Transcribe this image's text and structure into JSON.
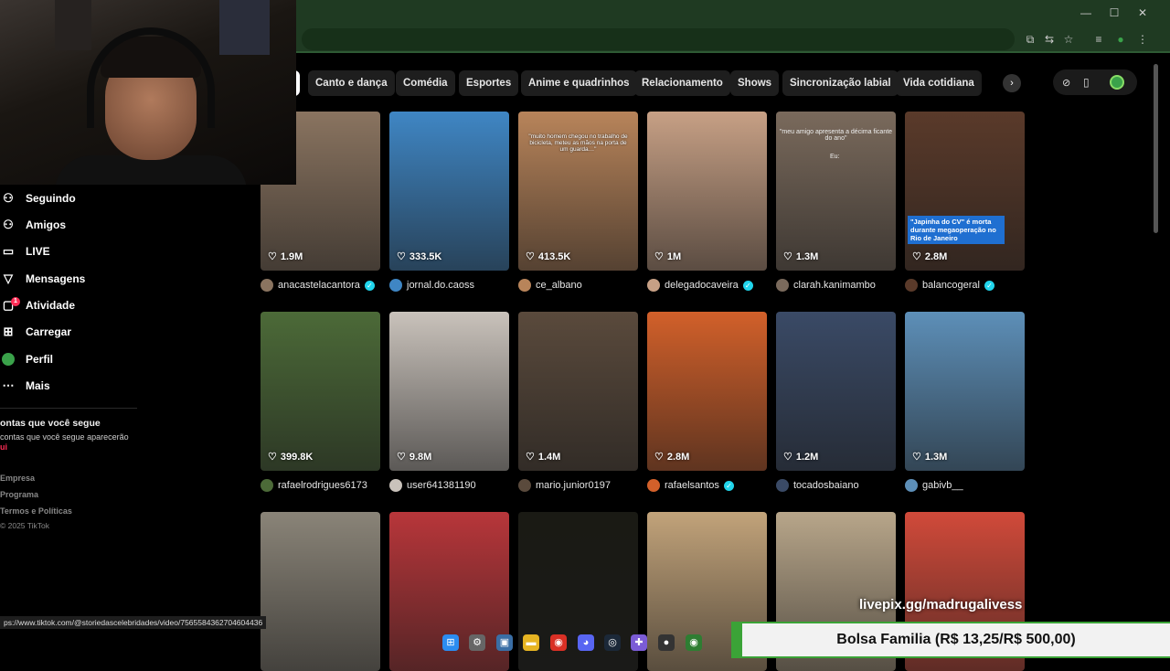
{
  "browser": {
    "window_controls": [
      "—",
      "☐",
      "✕"
    ],
    "toolbar_icons": [
      "⧉",
      "⇆",
      "☆",
      "≡",
      "●",
      "⋮"
    ]
  },
  "categories": [
    "Canto e dança",
    "Comédia",
    "Esportes",
    "Anime e quadrinhos",
    "Relacionamento",
    "Shows",
    "Sincronização labial",
    "Vida cotidiana"
  ],
  "nav": {
    "items": [
      {
        "label": "Seguindo",
        "icon": "following-icon"
      },
      {
        "label": "Amigos",
        "icon": "friends-icon"
      },
      {
        "label": "LIVE",
        "icon": "live-icon"
      },
      {
        "label": "Mensagens",
        "icon": "messages-icon"
      },
      {
        "label": "Atividade",
        "icon": "activity-icon",
        "badge": "1"
      },
      {
        "label": "Carregar",
        "icon": "upload-icon"
      },
      {
        "label": "Perfil",
        "icon": "profile-icon"
      },
      {
        "label": "Mais",
        "icon": "more-icon"
      }
    ],
    "following_title": "ontas que você segue",
    "following_hint": " contas que você segue aparecerão",
    "following_link": "ui"
  },
  "footer": {
    "links": [
      "Empresa",
      "Programa",
      "Termos e Políticas"
    ],
    "copyright": "© 2025 TikTok"
  },
  "videos": [
    {
      "likes": "1.9M",
      "author": "anacastelacantora",
      "verified": true
    },
    {
      "likes": "333.5K",
      "author": "jornal.do.caoss",
      "verified": false
    },
    {
      "likes": "413.5K",
      "author": "ce_albano",
      "verified": false
    },
    {
      "likes": "1M",
      "author": "delegadocaveira",
      "verified": true
    },
    {
      "likes": "1.3M",
      "author": "clarah.kanimambo",
      "verified": false
    },
    {
      "likes": "2.8M",
      "author": "balancogeral",
      "verified": true
    },
    {
      "likes": "399.8K",
      "author": "rafaelrodrigues6173",
      "verified": false
    },
    {
      "likes": "9.8M",
      "author": "user641381190",
      "verified": false
    },
    {
      "likes": "1.4M",
      "author": "mario.junior0197",
      "verified": false
    },
    {
      "likes": "2.8M",
      "author": "rafaelsantos",
      "verified": true
    },
    {
      "likes": "1.2M",
      "author": "tocadosbaiano",
      "verified": false
    },
    {
      "likes": "1.3M",
      "author": "gabivb__",
      "verified": false
    },
    {
      "likes": "",
      "author": "",
      "verified": false
    },
    {
      "likes": "",
      "author": "",
      "verified": false
    },
    {
      "likes": "",
      "author": "",
      "verified": false
    },
    {
      "likes": "",
      "author": "",
      "verified": false
    },
    {
      "likes": "",
      "author": "",
      "verified": false
    },
    {
      "likes": "",
      "author": "",
      "verified": false
    }
  ],
  "thumb_colors": [
    "#8a7460",
    "#3f86c4",
    "#b8845a",
    "#c7a085",
    "#7a6a5c",
    "#5a3a2a",
    "#4c6a38",
    "#c9c2bb",
    "#5a4a3c",
    "#d2602a",
    "#3a4a66",
    "#5d8fb8",
    "#8a8478",
    "#b8363a",
    "#1a1a14",
    "#c2a37a",
    "#b8a68a",
    "#d14a3a"
  ],
  "captions": {
    "video_2": "\"muito homem chegou no trabalho de bicicleta, meteu as mãos na porta de um guarda…\"",
    "video_4": "\"meu amigo apresenta a décima ficante do ano\"",
    "video_4_sub": "Eu:",
    "video_5": "\"Japinha do CV\" é morta durante megaoperação no Rio de Janeiro"
  },
  "status_url": "ps://www.tiktok.com/@storiedascelebridades/video/7565584362704604436",
  "overlay": {
    "livepix": "livepix.gg/madrugalivess",
    "bolsa": "Bolsa Familia (R$ 13,25/R$ 500,00)"
  },
  "taskbar": [
    {
      "name": "windows-icon",
      "glyph": "⊞",
      "color": "#2b8cf0"
    },
    {
      "name": "settings-icon",
      "glyph": "⚙",
      "color": "#666"
    },
    {
      "name": "photos-icon",
      "glyph": "▣",
      "color": "#3a6ea5"
    },
    {
      "name": "folder-icon",
      "glyph": "▬",
      "color": "#e6b422"
    },
    {
      "name": "chrome-icon",
      "glyph": "◉",
      "color": "#d93025"
    },
    {
      "name": "discord-icon",
      "glyph": "◕",
      "color": "#5865f2"
    },
    {
      "name": "steam-icon",
      "glyph": "◎",
      "color": "#1b2838"
    },
    {
      "name": "gamepad-icon",
      "glyph": "✚",
      "color": "#7b5cd6"
    },
    {
      "name": "obs-icon",
      "glyph": "●",
      "color": "#333"
    },
    {
      "name": "chrome-alt-icon",
      "glyph": "◉",
      "color": "#2e7d32"
    }
  ]
}
